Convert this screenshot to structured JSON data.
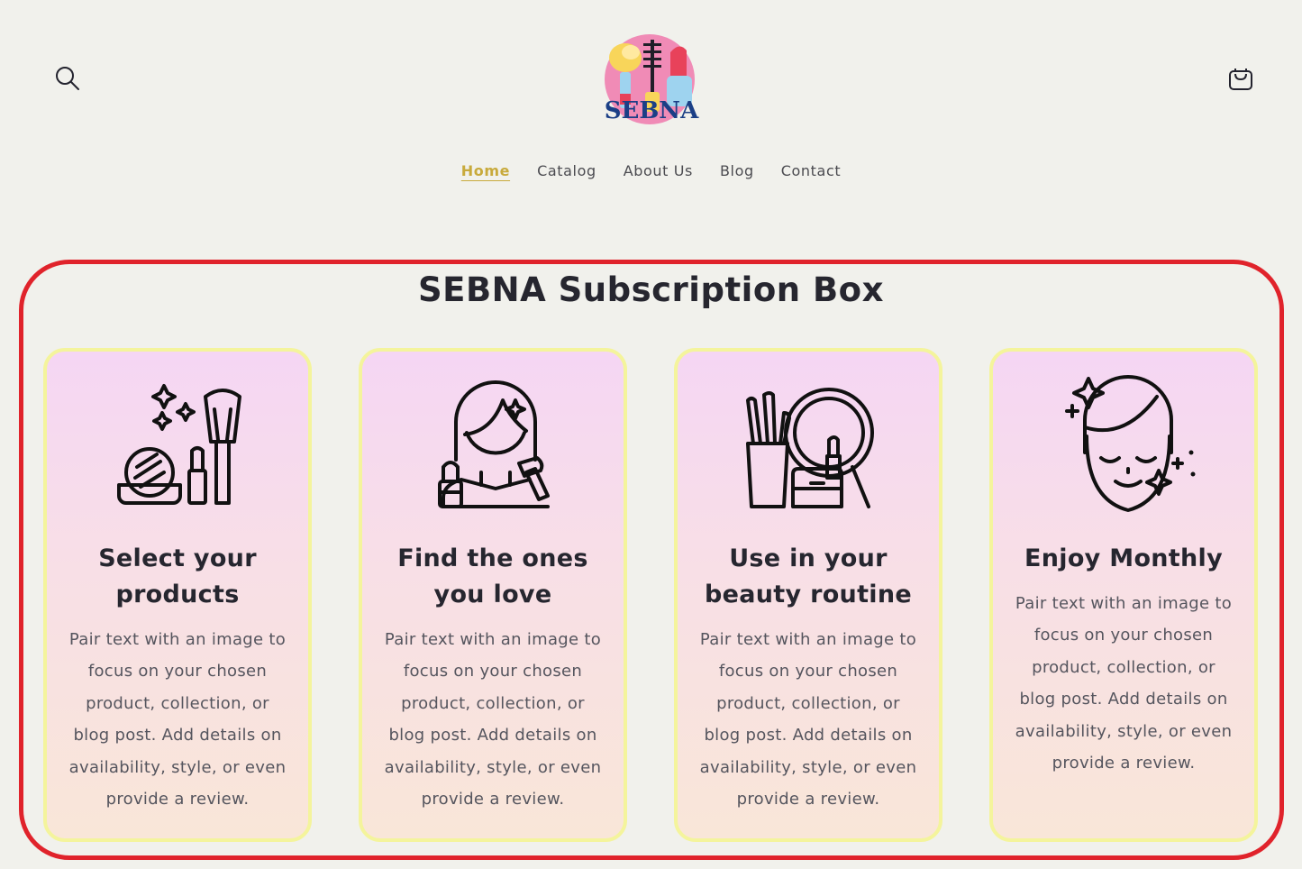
{
  "header": {
    "logo_text": "SEBNA",
    "nav": [
      "Home",
      "Catalog",
      "About Us",
      "Blog",
      "Contact"
    ],
    "active_nav": "Home"
  },
  "section": {
    "title": "SEBNA Subscription Box",
    "cards": [
      {
        "title_line1": "Select your",
        "title_line2": "products",
        "icon": "makeup-kit-icon",
        "text": "Pair text with an image to focus on your chosen product, collection, or blog post. Add details on availability, style, or even provide a review."
      },
      {
        "title_line1": "Find the ones",
        "title_line2": "you love",
        "icon": "woman-makeup-icon",
        "text": "Pair text with an image to focus on your chosen product, collection, or blog post. Add details on availability, style, or even provide a review."
      },
      {
        "title_line1": "Use in your",
        "title_line2": "beauty routine",
        "icon": "vanity-mirror-icon",
        "text": "Pair text with an image to focus on your chosen product, collection, or blog post. Add details on availability, style, or even provide a review."
      },
      {
        "title_line1": "Enjoy Monthly",
        "icon": "face-glow-icon",
        "text": "Pair text with an image to focus on your chosen product, collection, or blog post. Add details on availability, style, or even provide a review."
      }
    ]
  },
  "colors": {
    "background": "#f1f1ec",
    "accent": "#c8aa3c",
    "box_border": "#e0232b",
    "card_border": "#f4f49c",
    "logo_text": "#1b3f86"
  }
}
